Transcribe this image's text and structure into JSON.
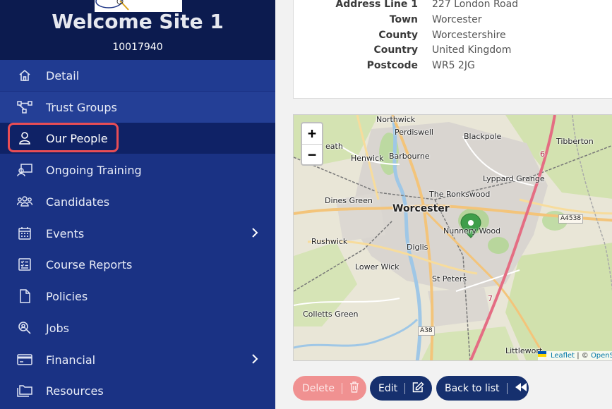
{
  "sidebar": {
    "title": "Welcome Site 1",
    "code": "10017940",
    "items": [
      {
        "label": "Detail",
        "icon": "home-icon"
      },
      {
        "label": "Trust Groups",
        "icon": "hierarchy-icon"
      },
      {
        "label": "Our People",
        "icon": "user-icon"
      },
      {
        "label": "Ongoing Training",
        "icon": "training-icon"
      },
      {
        "label": "Candidates",
        "icon": "users-group-icon"
      },
      {
        "label": "Events",
        "icon": "calendar-icon"
      },
      {
        "label": "Course Reports",
        "icon": "checklist-icon"
      },
      {
        "label": "Policies",
        "icon": "document-icon"
      },
      {
        "label": "Jobs",
        "icon": "search-icon"
      },
      {
        "label": "Financial",
        "icon": "credit-card-icon"
      },
      {
        "label": "Resources",
        "icon": "folders-icon"
      }
    ]
  },
  "address": {
    "rows": [
      {
        "label": "Address Line 1",
        "value": "227 London Road"
      },
      {
        "label": "Town",
        "value": "Worcester"
      },
      {
        "label": "County",
        "value": "Worcestershire"
      },
      {
        "label": "Country",
        "value": "United Kingdom"
      },
      {
        "label": "Postcode",
        "value": "WR5 2JG"
      }
    ]
  },
  "map": {
    "zoom_in": "+",
    "zoom_out": "−",
    "labels": {
      "northwick": "Northwick",
      "perdiswell": "Perdiswell",
      "blackpole": "Blackpole",
      "tibberton": "Tibberton",
      "heath": "eath",
      "henwick": "Henwick",
      "barbourne": "Barbourne",
      "lyppard": "Lyppard Grange",
      "ronkswood": "The Ronkswood",
      "dines": "Dines Green",
      "worcester": "Worcester",
      "rushwick": "Rushwick",
      "nunnery": "Nunnery Wood",
      "diglis": "Diglis",
      "lowerwick": "Lower Wick",
      "stpeters": "St Peters",
      "colletts": "Colletts Green",
      "littleworth": "Littlewort"
    },
    "roads": {
      "a4538": "A4538",
      "a38": "A38",
      "r6": "6",
      "r7": "7"
    },
    "attribution": {
      "leaflet": "Leaflet",
      "sep": "| ©",
      "osm": "OpenS"
    },
    "colors": {
      "marker": "#3f9e4a",
      "motorway": "#e26c82",
      "primary": "#f4c778",
      "urban": "#d8d4cf",
      "green": "#c9dfa6"
    }
  },
  "buttons": {
    "delete": "Delete",
    "edit": "Edit",
    "back": "Back to list"
  }
}
